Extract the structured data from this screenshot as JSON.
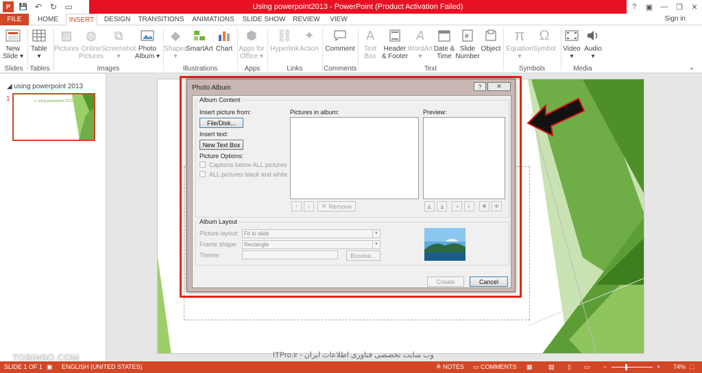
{
  "window": {
    "title": "Using powerpoint2013 -  PowerPoint (Product Activation Failed)",
    "help": "?",
    "minimize": "—",
    "restore": "❐",
    "close": "✕",
    "signin": "Sign in"
  },
  "qat": {
    "save": "💾",
    "undo": "↶",
    "redo": "↻",
    "slideshow": "▭"
  },
  "tabs": [
    "FILE",
    "HOME",
    "INSERT",
    "DESIGN",
    "TRANSITIONS",
    "ANIMATIONS",
    "SLIDE SHOW",
    "REVIEW",
    "VIEW"
  ],
  "active_tab": "INSERT",
  "ribbon": {
    "slides": {
      "new_slide": "New\nSlide ▾",
      "group": "Slides"
    },
    "tables": {
      "table": "Table\n▾",
      "group": "Tables"
    },
    "images": {
      "pictures": "Pictures",
      "online_pictures": "Online\nPictures",
      "screenshot": "Screenshot\n▾",
      "photo_album": "Photo\nAlbum ▾",
      "group": "Images"
    },
    "illustrations": {
      "shapes": "Shapes\n▾",
      "smartart": "SmartArt",
      "chart": "Chart",
      "group": "Illustrations"
    },
    "apps": {
      "apps_for_office": "Apps for\nOffice ▾",
      "group": "Apps"
    },
    "links": {
      "hyperlink": "Hyperlink",
      "action": "Action",
      "group": "Links"
    },
    "comments": {
      "comment": "Comment",
      "group": "Comments"
    },
    "text": {
      "text_box": "Text\nBox",
      "header_footer": "Header\n& Footer",
      "wordart": "WordArt\n▾",
      "date_time": "Date &\nTime",
      "slide_number": "Slide\nNumber",
      "object": "Object",
      "group": "Text"
    },
    "symbols": {
      "equation": "Equation\n▾",
      "symbol": "Symbol",
      "group": "Symbols"
    },
    "media": {
      "video": "Video\n▾",
      "audio": "Audio\n▾",
      "group": "Media"
    }
  },
  "slides_panel": {
    "section": "◢ using powerpoint 2013",
    "slide_number": "1",
    "thumb_title": "✔ using powerpoint 2013"
  },
  "dialog": {
    "title": "Photo Album",
    "album_content": "Album Content",
    "insert_picture_from": "Insert picture from:",
    "file_disk": "File/Disk...",
    "insert_text": "Insert text:",
    "new_text_box": "New Text Box",
    "picture_options": "Picture Options:",
    "captions_below": "Captions below ALL pictures",
    "all_black_white": "ALL pictures black and white",
    "pictures_in_album": "Pictures in album:",
    "preview": "Preview:",
    "remove": "Remove",
    "album_layout": "Album Layout",
    "picture_layout_label": "Picture layout:",
    "picture_layout_value": "Fit to slide",
    "frame_shape_label": "Frame shape:",
    "frame_shape_value": "Rectangle",
    "theme_label": "Theme:",
    "browse": "Browse...",
    "create": "Create",
    "cancel": "Cancel"
  },
  "statusbar": {
    "slide_of": "SLIDE 1 OF 1",
    "language": "ENGLISH (UNITED STATES)",
    "notes": "≜ NOTES",
    "comments": "▭ COMMENTS",
    "zoom": "74%"
  },
  "watermarks": {
    "left": "TOSINSO.COM",
    "center": "ITPro.ir - وب سایت تخصصی فناوری اطلاعات ایران"
  },
  "colors": {
    "accent": "#d24726",
    "title_red": "#e81123",
    "highlight": "#e0241b",
    "slide_green": "#70ad47"
  }
}
